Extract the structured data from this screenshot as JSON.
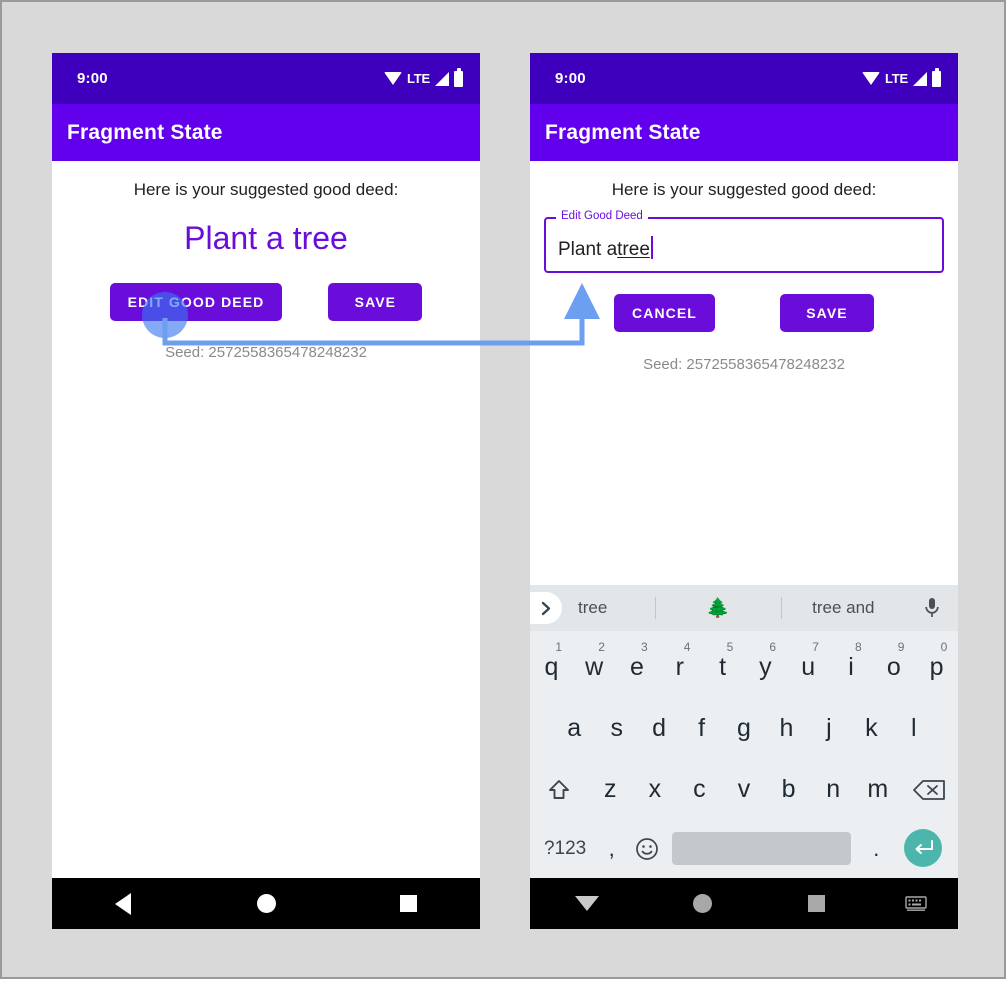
{
  "background_color": "#d9d9d9",
  "theme": {
    "status_bar_color": "#3f00be",
    "app_bar_color": "#6200ee",
    "primary_color": "#6a0dda",
    "accent_text_color": "#6a0dda",
    "touch_indicator_color": "#3876f0",
    "annotation_arrow_color": "#6c9ff0",
    "keyboard_bg": "#eceff1",
    "suggestion_bg": "#e3e6e8",
    "enter_key_color": "#4db6ac",
    "spacebar_color": "#c4c8ca"
  },
  "phone_left": {
    "status_bar": {
      "time": "9:00",
      "icons": [
        "wifi-icon",
        "lte-label",
        "signal-icon",
        "battery-icon"
      ],
      "lte_label": "LTE"
    },
    "app_bar": {
      "title": "Fragment State"
    },
    "content": {
      "prompt": "Here is your suggested good deed:",
      "deed": "Plant a tree",
      "seed": "Seed: 2572558365478248232"
    },
    "buttons": [
      {
        "label": "EDIT GOOD DEED",
        "name": "edit-good-deed-button"
      },
      {
        "label": "SAVE",
        "name": "save-button"
      }
    ],
    "touch_indicator": {
      "name": "touch-indicator",
      "target": "EDIT GOOD DEED"
    },
    "nav_bar": {
      "items": [
        {
          "name": "nav-back-button",
          "icon": "back-triangle-icon"
        },
        {
          "name": "nav-home-button",
          "icon": "home-circle-icon"
        },
        {
          "name": "nav-recents-button",
          "icon": "recents-square-icon"
        }
      ]
    }
  },
  "phone_right": {
    "status_bar": {
      "time": "9:00",
      "icons": [
        "wifi-icon",
        "lte-label",
        "signal-icon",
        "battery-icon"
      ],
      "lte_label": "LTE"
    },
    "app_bar": {
      "title": "Fragment State"
    },
    "content": {
      "prompt": "Here is your suggested good deed:",
      "seed": "Seed: 2572558365478248232"
    },
    "text_field": {
      "label": "Edit Good Deed",
      "value": "Plant a ",
      "value_misspelled": "tree",
      "full_value": "Plant a tree",
      "focused": true
    },
    "buttons": [
      {
        "label": "CANCEL",
        "name": "cancel-button"
      },
      {
        "label": "SAVE",
        "name": "save-button"
      }
    ],
    "keyboard": {
      "suggestions": [
        {
          "text": "tree",
          "name": "suggestion-tree"
        },
        {
          "text": "🌲",
          "name": "suggestion-tree-emoji"
        },
        {
          "text": "tree and",
          "name": "suggestion-tree-and"
        }
      ],
      "expand_icon": "chevron-right-icon",
      "mic_icon": "microphone-icon",
      "row1": [
        {
          "key": "q",
          "num": "1"
        },
        {
          "key": "w",
          "num": "2"
        },
        {
          "key": "e",
          "num": "3"
        },
        {
          "key": "r",
          "num": "4"
        },
        {
          "key": "t",
          "num": "5"
        },
        {
          "key": "y",
          "num": "6"
        },
        {
          "key": "u",
          "num": "7"
        },
        {
          "key": "i",
          "num": "8"
        },
        {
          "key": "o",
          "num": "9"
        },
        {
          "key": "p",
          "num": "0"
        }
      ],
      "row2": [
        "a",
        "s",
        "d",
        "f",
        "g",
        "h",
        "j",
        "k",
        "l"
      ],
      "row3": [
        "z",
        "x",
        "c",
        "v",
        "b",
        "n",
        "m"
      ],
      "shift_icon": "shift-up-arrow-icon",
      "backspace_icon": "backspace-icon",
      "row4": {
        "symbols_label": "?123",
        "comma": ",",
        "emoji_icon": "emoji-smiley-icon",
        "space": "",
        "period": ".",
        "enter_icon": "enter-return-icon"
      }
    },
    "nav_bar": {
      "items": [
        {
          "name": "nav-dismiss-keyboard-button",
          "icon": "down-triangle-icon"
        },
        {
          "name": "nav-home-button",
          "icon": "home-circle-icon"
        },
        {
          "name": "nav-recents-button",
          "icon": "recents-square-icon"
        },
        {
          "name": "nav-keyboard-switch-button",
          "icon": "keyboard-icon"
        }
      ]
    }
  },
  "annotation": {
    "name": "flow-arrow",
    "description": "arrow from edit good deed button to text field"
  }
}
